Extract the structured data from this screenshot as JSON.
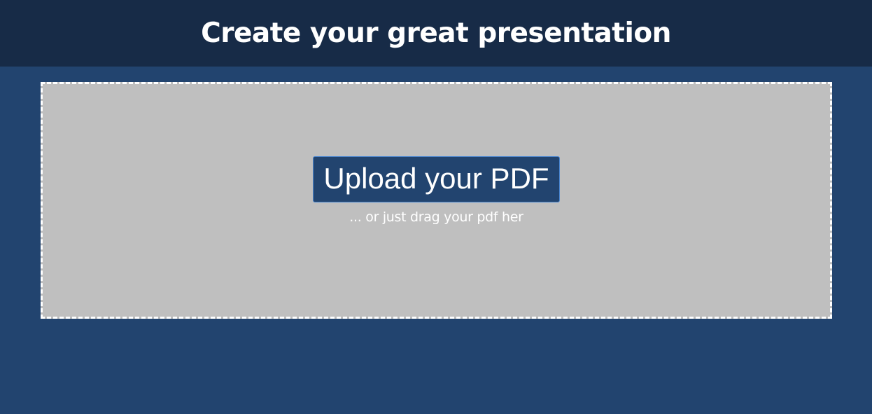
{
  "header": {
    "title": "Create your great presentation"
  },
  "dropzone": {
    "upload_button_label": "Upload your PDF",
    "hint_text": "... or just drag your pdf her"
  },
  "colors": {
    "page_background": "#22446f",
    "header_background": "#172b47",
    "dropzone_background": "#bfbfbf",
    "dropzone_border": "#ffffff",
    "button_background": "#22446f",
    "button_border": "#4a86d0",
    "text": "#ffffff"
  }
}
